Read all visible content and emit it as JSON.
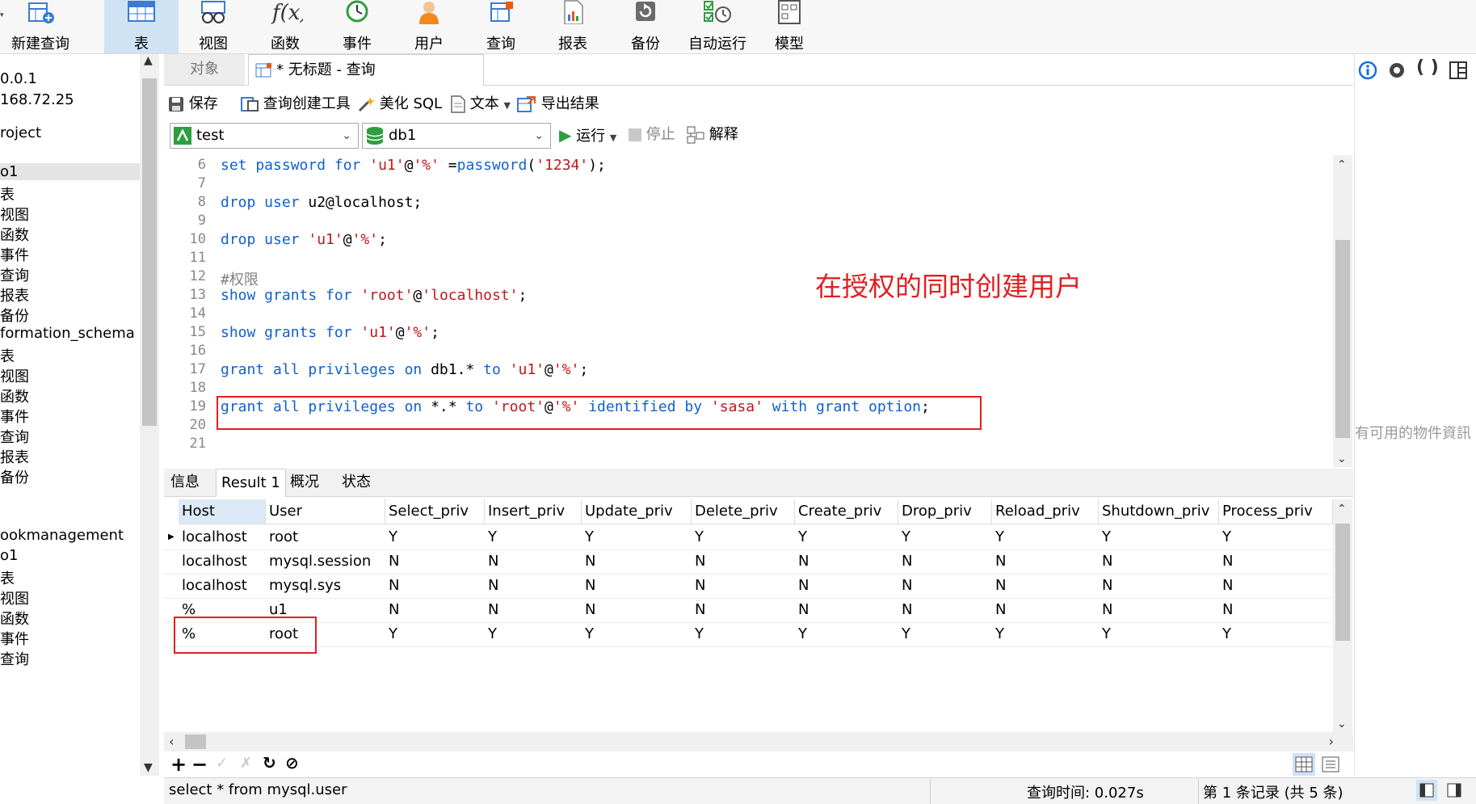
{
  "toolbar": {
    "items": [
      {
        "label": "新建查询",
        "icon": "new-query-icon"
      },
      {
        "label": "表",
        "icon": "table-icon",
        "active": true
      },
      {
        "label": "视图",
        "icon": "view-icon"
      },
      {
        "label": "函数",
        "icon": "function-icon"
      },
      {
        "label": "事件",
        "icon": "event-clock-icon"
      },
      {
        "label": "用户",
        "icon": "user-icon"
      },
      {
        "label": "查询",
        "icon": "query-icon"
      },
      {
        "label": "报表",
        "icon": "report-icon"
      },
      {
        "label": "备份",
        "icon": "backup-icon"
      },
      {
        "label": "自动运行",
        "icon": "auto-run-icon"
      },
      {
        "label": "模型",
        "icon": "model-icon"
      }
    ]
  },
  "navigator": {
    "items": [
      {
        "label": "0.0.1"
      },
      {
        "label": "168.72.25"
      },
      {
        "label": "roject"
      },
      {
        "label": "o1",
        "selected": true
      },
      {
        "label": "表"
      },
      {
        "label": "视图"
      },
      {
        "label": "函数"
      },
      {
        "label": "事件"
      },
      {
        "label": "查询"
      },
      {
        "label": "报表"
      },
      {
        "label": "备份"
      },
      {
        "label": "formation_schema"
      },
      {
        "label": "表"
      },
      {
        "label": "视图"
      },
      {
        "label": "函数"
      },
      {
        "label": "事件"
      },
      {
        "label": "查询"
      },
      {
        "label": "报表"
      },
      {
        "label": "备份"
      },
      {
        "label": "ookmanagement"
      },
      {
        "label": "o1"
      },
      {
        "label": "表"
      },
      {
        "label": "视图"
      },
      {
        "label": "函数"
      },
      {
        "label": "事件"
      },
      {
        "label": "查询"
      }
    ]
  },
  "tabs": {
    "objects": "对象",
    "query": "* 无标题 - 查询"
  },
  "query_toolbar": {
    "save": "保存",
    "builder": "查询创建工具",
    "beautify": "美化 SQL",
    "text": "文本",
    "export": "导出结果",
    "connection": "test",
    "database": "db1",
    "run": "运行",
    "stop": "停止",
    "explain": "解释"
  },
  "editor": {
    "lines": [
      {
        "n": "6",
        "tokens": [
          [
            "kw",
            "set password for "
          ],
          [
            "str",
            "'u1'"
          ],
          [
            "",
            "@"
          ],
          [
            "str",
            "'%'"
          ],
          [
            "",
            " ="
          ],
          [
            "kw",
            "password"
          ],
          [
            "",
            "("
          ],
          [
            "str",
            "'1234'"
          ],
          [
            "",
            ");"
          ]
        ]
      },
      {
        "n": "7",
        "tokens": []
      },
      {
        "n": "8",
        "tokens": [
          [
            "kw",
            "drop user "
          ],
          [
            "",
            "u2@localhost;"
          ]
        ]
      },
      {
        "n": "9",
        "tokens": []
      },
      {
        "n": "10",
        "tokens": [
          [
            "kw",
            "drop user "
          ],
          [
            "str",
            "'u1'"
          ],
          [
            "",
            "@"
          ],
          [
            "str",
            "'%'"
          ],
          [
            "",
            ";"
          ]
        ]
      },
      {
        "n": "11",
        "tokens": []
      },
      {
        "n": "12",
        "tokens": [
          [
            "cmt",
            "#权限"
          ]
        ]
      },
      {
        "n": "13",
        "tokens": [
          [
            "kw",
            "show grants for "
          ],
          [
            "str",
            "'root'"
          ],
          [
            "",
            "@"
          ],
          [
            "str",
            "'localhost'"
          ],
          [
            "",
            ";"
          ]
        ]
      },
      {
        "n": "14",
        "tokens": []
      },
      {
        "n": "15",
        "tokens": [
          [
            "kw",
            "show grants for "
          ],
          [
            "str",
            "'u1'"
          ],
          [
            "",
            "@"
          ],
          [
            "str",
            "'%'"
          ],
          [
            "",
            ";"
          ]
        ]
      },
      {
        "n": "16",
        "tokens": []
      },
      {
        "n": "17",
        "tokens": [
          [
            "kw",
            "grant all privileges on "
          ],
          [
            "",
            "db1.* "
          ],
          [
            "kw",
            "to "
          ],
          [
            "str",
            "'u1'"
          ],
          [
            "",
            "@"
          ],
          [
            "str",
            "'%'"
          ],
          [
            "",
            ";"
          ]
        ]
      },
      {
        "n": "18",
        "tokens": []
      },
      {
        "n": "19",
        "tokens": [
          [
            "kw",
            "grant all privileges on "
          ],
          [
            "",
            "*.* "
          ],
          [
            "kw",
            "to "
          ],
          [
            "str",
            "'root'"
          ],
          [
            "",
            "@"
          ],
          [
            "str",
            "'%'"
          ],
          [
            "kw",
            " identified by "
          ],
          [
            "str",
            "'sasa'"
          ],
          [
            "kw",
            " with grant option"
          ],
          [
            "",
            ";"
          ]
        ]
      },
      {
        "n": "20",
        "tokens": []
      },
      {
        "n": "21",
        "tokens": []
      }
    ],
    "annotation": "在授权的同时创建用户"
  },
  "result_tabs": [
    "信息",
    "Result 1",
    "概况",
    "状态"
  ],
  "grid": {
    "columns": [
      "Host",
      "User",
      "Select_priv",
      "Insert_priv",
      "Update_priv",
      "Delete_priv",
      "Create_priv",
      "Drop_priv",
      "Reload_priv",
      "Shutdown_priv",
      "Process_priv"
    ],
    "rows": [
      [
        "localhost",
        "root",
        "Y",
        "Y",
        "Y",
        "Y",
        "Y",
        "Y",
        "Y",
        "Y",
        "Y"
      ],
      [
        "localhost",
        "mysql.session",
        "N",
        "N",
        "N",
        "N",
        "N",
        "N",
        "N",
        "N",
        "N"
      ],
      [
        "localhost",
        "mysql.sys",
        "N",
        "N",
        "N",
        "N",
        "N",
        "N",
        "N",
        "N",
        "N"
      ],
      [
        "%",
        "u1",
        "N",
        "N",
        "N",
        "N",
        "N",
        "N",
        "N",
        "N",
        "N"
      ],
      [
        "%",
        "root",
        "Y",
        "Y",
        "Y",
        "Y",
        "Y",
        "Y",
        "Y",
        "Y",
        "Y"
      ]
    ]
  },
  "status": {
    "sql": "select * from mysql.user",
    "time": "查询时间: 0.027s",
    "records": "第 1 条记录 (共 5 条)"
  },
  "right_panel": {
    "text": "有可用的物件資訊"
  },
  "colors": {
    "keyword": "#1060d0",
    "string": "#c01818",
    "annotation": "#e02020",
    "highlight": "#cfe3f5"
  }
}
